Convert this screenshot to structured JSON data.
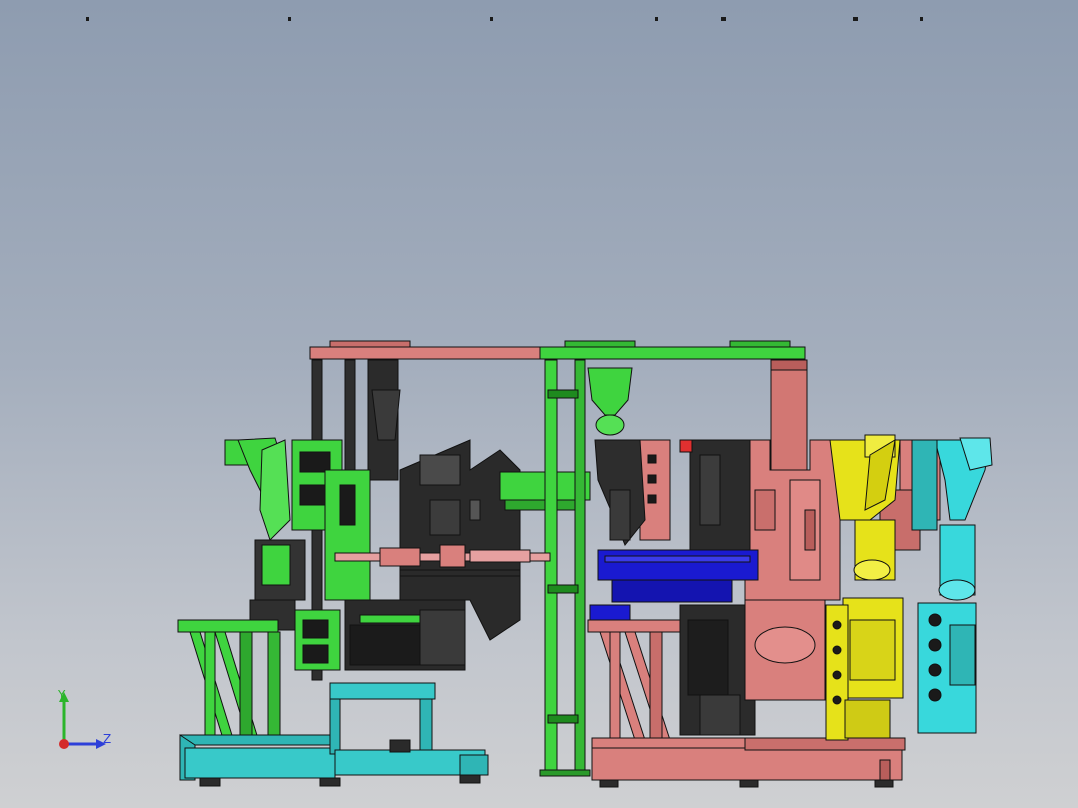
{
  "viewport": {
    "background_top": "#8e9cb0",
    "background_bottom": "#cfd0d2"
  },
  "triad": {
    "y_label": "Y",
    "z_label": "Z",
    "y_color": "#2bb52b",
    "z_color": "#2d3fd9",
    "x_color": "#d42a2a"
  },
  "colors": {
    "green": "#3fd43f",
    "dark_green": "#1e8a1e",
    "salmon": "#d9807d",
    "dark_salmon": "#b55a58",
    "black": "#2a2a2a",
    "teal": "#2fb5b5",
    "cyan": "#38d8dc",
    "yellow": "#e6e21a",
    "blue": "#1a1ad0",
    "pink": "#e6a0a0"
  }
}
